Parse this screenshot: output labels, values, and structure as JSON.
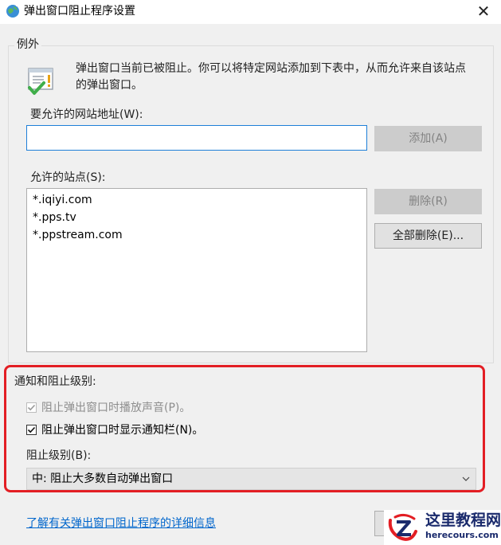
{
  "window": {
    "title": "弹出窗口阻止程序设置",
    "close_glyph": "✕"
  },
  "exceptions": {
    "group_label": "例外",
    "info_text": "弹出窗口当前已被阻止。你可以将特定网站添加到下表中，从而允许来自该站点的弹出窗口。",
    "address_label": "要允许的网站地址(W):",
    "address_value": "",
    "add_button": "添加(A)",
    "allowed_sites_label": "允许的站点(S):",
    "allowed_sites": [
      "*.iqiyi.com",
      "*.pps.tv",
      "*.ppstream.com"
    ],
    "remove_button": "删除(R)",
    "remove_all_button": "全部删除(E)..."
  },
  "notifications": {
    "section_label": "通知和阻止级别:",
    "play_sound": {
      "label": "阻止弹出窗口时播放声音(P)。",
      "checked": true,
      "enabled": false
    },
    "show_bar": {
      "label": "阻止弹出窗口时显示通知栏(N)。",
      "checked": true,
      "enabled": true
    },
    "level_label": "阻止级别(B):",
    "level_value": "中: 阻止大多数自动弹出窗口"
  },
  "footer": {
    "help_link": "了解有关弹出窗口阻止程序的详细信息"
  },
  "watermark": {
    "title": "这里教程网",
    "url": "herecours.com"
  },
  "colors": {
    "highlight": "#e31e24",
    "link": "#0066cc",
    "input_focus": "#1e7fd8"
  }
}
